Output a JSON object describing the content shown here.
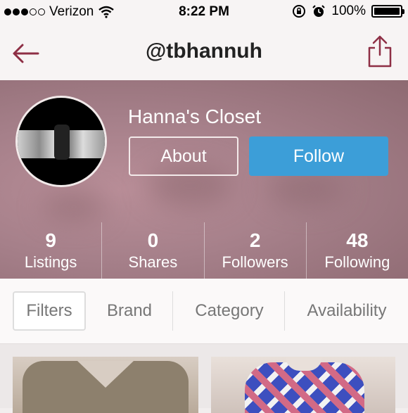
{
  "status_bar": {
    "carrier": "Verizon",
    "time": "8:22 PM",
    "battery": "100%",
    "signal_bars": 3
  },
  "nav": {
    "title": "@tbhannuh",
    "back_icon": "back-arrow-icon",
    "share_icon": "share-icon",
    "accent_color": "#8e2f45"
  },
  "profile": {
    "closet_name": "Hanna's Closet",
    "about_label": "About",
    "follow_label": "Follow",
    "follow_color": "#3c9ed8"
  },
  "stats": [
    {
      "value": "9",
      "label": "Listings"
    },
    {
      "value": "0",
      "label": "Shares"
    },
    {
      "value": "2",
      "label": "Followers"
    },
    {
      "value": "48",
      "label": "Following"
    }
  ],
  "filters": {
    "filters_label": "Filters",
    "brand_label": "Brand",
    "category_label": "Category",
    "availability_label": "Availability"
  }
}
